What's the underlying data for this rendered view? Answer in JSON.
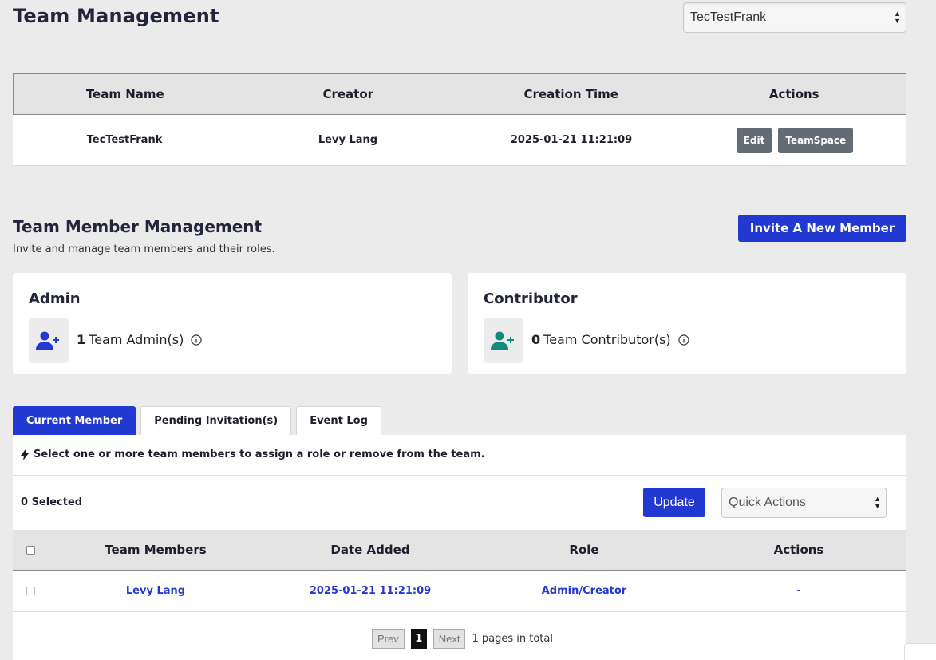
{
  "header": {
    "title": "Team Management",
    "team_selector_value": "TecTestFrank"
  },
  "team_table": {
    "columns": [
      "Team Name",
      "Creator",
      "Creation Time",
      "Actions"
    ],
    "row": {
      "team_name": "TecTestFrank",
      "creator": "Levy Lang",
      "creation_time": "2025-01-21 11:21:09",
      "edit_label": "Edit",
      "teamspace_label": "TeamSpace"
    }
  },
  "member_management": {
    "title": "Team Member Management",
    "subtitle": "Invite and manage team members and their roles.",
    "invite_label": "Invite A New Member"
  },
  "role_cards": {
    "admin": {
      "title": "Admin",
      "count": "1",
      "label": "Team Admin(s)",
      "icon": "user-plus-icon",
      "icon_color": "#2139d0"
    },
    "contributor": {
      "title": "Contributor",
      "count": "0",
      "label": "Team Contributor(s)",
      "icon": "user-plus-icon",
      "icon_color": "#138a7a"
    }
  },
  "tabs": [
    {
      "label": "Current Member",
      "active": true
    },
    {
      "label": "Pending Invitation(s)",
      "active": false
    },
    {
      "label": "Event Log",
      "active": false
    }
  ],
  "members_panel": {
    "hint": "Select one or more team members to assign a role or remove from the team.",
    "selected_count": "0 Selected",
    "update_label": "Update",
    "quick_actions_value": "Quick Actions",
    "columns": [
      "Team Members",
      "Date Added",
      "Role",
      "Actions"
    ],
    "rows": [
      {
        "member": "Levy Lang",
        "date_added": "2025-01-21 11:21:09",
        "role": "Admin/Creator",
        "actions": "-"
      }
    ]
  },
  "pagination": {
    "prev": "Prev",
    "current": "1",
    "next": "Next",
    "total": "1 pages in total"
  },
  "colors": {
    "primary": "#2139d0",
    "button_gray": "#636b75",
    "background": "#ebebeb"
  }
}
